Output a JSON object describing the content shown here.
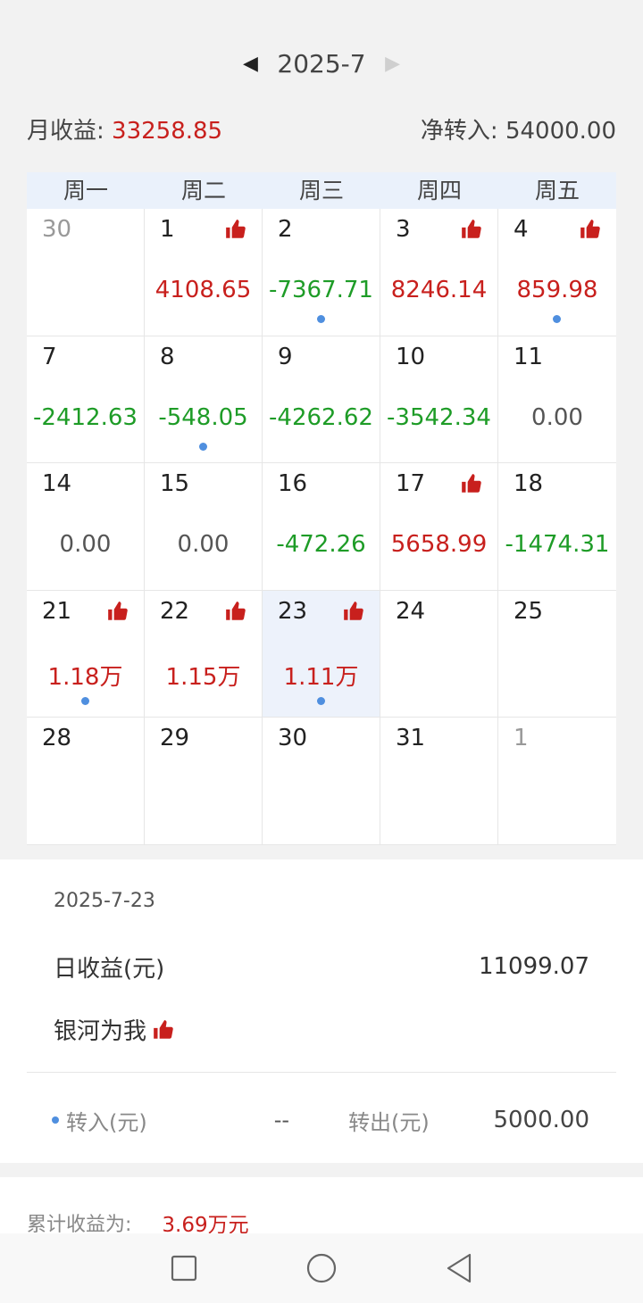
{
  "month_nav": {
    "prev": "◀",
    "label": "2025-7",
    "next": "▶"
  },
  "summary": {
    "month_income_label": "月收益:",
    "month_income_value": "33258.85",
    "net_transfer_label": "净转入:",
    "net_transfer_value": "54000.00"
  },
  "calendar": {
    "weekdays": [
      "周一",
      "周二",
      "周三",
      "周四",
      "周五"
    ],
    "colors": {
      "red": "#c8201d",
      "green": "#1e9c27",
      "dot": "#4f8fdf",
      "header_bg": "#eaf1fb",
      "selected_bg": "#edf2fb"
    },
    "cells": [
      {
        "day": "30",
        "value": "",
        "color": "",
        "thumb": false,
        "dot": false,
        "muted": true,
        "selected": false
      },
      {
        "day": "1",
        "value": "4108.65",
        "color": "red",
        "thumb": true,
        "dot": false,
        "muted": false,
        "selected": false
      },
      {
        "day": "2",
        "value": "-7367.71",
        "color": "green",
        "thumb": false,
        "dot": true,
        "muted": false,
        "selected": false
      },
      {
        "day": "3",
        "value": "8246.14",
        "color": "red",
        "thumb": true,
        "dot": false,
        "muted": false,
        "selected": false
      },
      {
        "day": "4",
        "value": "859.98",
        "color": "red",
        "thumb": true,
        "dot": true,
        "muted": false,
        "selected": false
      },
      {
        "day": "7",
        "value": "-2412.63",
        "color": "green",
        "thumb": false,
        "dot": false,
        "muted": false,
        "selected": false
      },
      {
        "day": "8",
        "value": "-548.05",
        "color": "green",
        "thumb": false,
        "dot": true,
        "muted": false,
        "selected": false
      },
      {
        "day": "9",
        "value": "-4262.62",
        "color": "green",
        "thumb": false,
        "dot": false,
        "muted": false,
        "selected": false
      },
      {
        "day": "10",
        "value": "-3542.34",
        "color": "green",
        "thumb": false,
        "dot": false,
        "muted": false,
        "selected": false
      },
      {
        "day": "11",
        "value": "0.00",
        "color": "gray",
        "thumb": false,
        "dot": false,
        "muted": false,
        "selected": false
      },
      {
        "day": "14",
        "value": "0.00",
        "color": "gray",
        "thumb": false,
        "dot": false,
        "muted": false,
        "selected": false
      },
      {
        "day": "15",
        "value": "0.00",
        "color": "gray",
        "thumb": false,
        "dot": false,
        "muted": false,
        "selected": false
      },
      {
        "day": "16",
        "value": "-472.26",
        "color": "green",
        "thumb": false,
        "dot": false,
        "muted": false,
        "selected": false
      },
      {
        "day": "17",
        "value": "5658.99",
        "color": "red",
        "thumb": true,
        "dot": false,
        "muted": false,
        "selected": false
      },
      {
        "day": "18",
        "value": "-1474.31",
        "color": "green",
        "thumb": false,
        "dot": false,
        "muted": false,
        "selected": false
      },
      {
        "day": "21",
        "value": "1.18万",
        "color": "red",
        "thumb": true,
        "dot": true,
        "muted": false,
        "selected": false
      },
      {
        "day": "22",
        "value": "1.15万",
        "color": "red",
        "thumb": true,
        "dot": false,
        "muted": false,
        "selected": false
      },
      {
        "day": "23",
        "value": "1.11万",
        "color": "red",
        "thumb": true,
        "dot": true,
        "muted": false,
        "selected": true
      },
      {
        "day": "24",
        "value": "",
        "color": "",
        "thumb": false,
        "dot": false,
        "muted": false,
        "selected": false
      },
      {
        "day": "25",
        "value": "",
        "color": "",
        "thumb": false,
        "dot": false,
        "muted": false,
        "selected": false
      },
      {
        "day": "28",
        "value": "",
        "color": "",
        "thumb": false,
        "dot": false,
        "muted": false,
        "selected": false
      },
      {
        "day": "29",
        "value": "",
        "color": "",
        "thumb": false,
        "dot": false,
        "muted": false,
        "selected": false
      },
      {
        "day": "30",
        "value": "",
        "color": "",
        "thumb": false,
        "dot": false,
        "muted": false,
        "selected": false
      },
      {
        "day": "31",
        "value": "",
        "color": "",
        "thumb": false,
        "dot": false,
        "muted": false,
        "selected": false
      },
      {
        "day": "1",
        "value": "",
        "color": "",
        "thumb": false,
        "dot": false,
        "muted": true,
        "selected": false
      }
    ]
  },
  "detail": {
    "date": "2025-7-23",
    "daily_income_label": "日收益(元)",
    "daily_income_value": "11099.07",
    "title": "银河为我",
    "title_icon": "thumbs-up-icon",
    "transfer_in_label": "转入(元)",
    "transfer_in_value": "--",
    "transfer_out_label": "转出(元)",
    "transfer_out_value": "5000.00"
  },
  "cumulative": {
    "label": "累计收益为:",
    "value": "3.69万元"
  },
  "system_nav": {
    "icons": [
      "square-recents-icon",
      "circle-home-icon",
      "triangle-back-icon"
    ]
  }
}
